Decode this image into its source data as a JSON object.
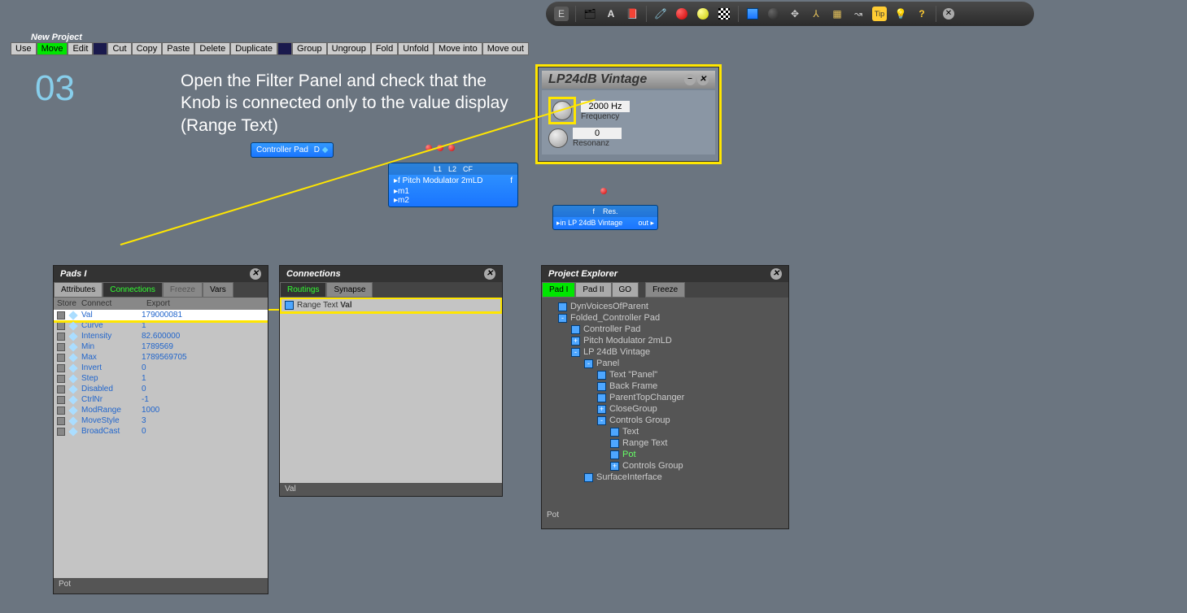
{
  "window_title": "New Project",
  "step_number": "03",
  "step_text": "Open the Filter Panel and check that the Knob is connected only to the value display (Range Text)",
  "mode_buttons": {
    "use": "Use",
    "move": "Move",
    "edit": "Edit"
  },
  "edit_buttons": [
    "Cut",
    "Copy",
    "Paste",
    "Delete",
    "Duplicate"
  ],
  "group_buttons": [
    "Group",
    "Ungroup",
    "Fold",
    "Unfold",
    "Move into",
    "Move out"
  ],
  "controller_pad": {
    "label": "Controller Pad",
    "port": "D"
  },
  "pitch_mod": {
    "title": "Pitch Modulator 2mLD",
    "l1": "L1",
    "l2": "L2",
    "cf": "CF",
    "in1": "m1",
    "in2": "m2",
    "out": "f"
  },
  "lp_node": {
    "f": "f",
    "res": "Res.",
    "in": "in",
    "name": "LP 24dB Vintage",
    "out": "out"
  },
  "filter_panel": {
    "title": "LP24dB Vintage",
    "freq_val": "2000 Hz",
    "freq_label": "Frequency",
    "res_val": "0",
    "res_label": "Resonanz"
  },
  "pads_panel": {
    "title": "Pads I",
    "tabs": {
      "attributes": "Attributes",
      "connections": "Connections",
      "freeze": "Freeze",
      "vars": "Vars"
    },
    "header": {
      "store": "Store",
      "connect": "Connect",
      "export": "Export"
    },
    "rows": [
      {
        "name": "Val",
        "val": "179000081",
        "hl": true
      },
      {
        "name": "Curve",
        "val": "1"
      },
      {
        "name": "Intensity",
        "val": "82.600000"
      },
      {
        "name": "Min",
        "val": "1789569"
      },
      {
        "name": "Max",
        "val": "1789569705"
      },
      {
        "name": "Invert",
        "val": "0"
      },
      {
        "name": "Step",
        "val": "1"
      },
      {
        "name": "Disabled",
        "val": "0"
      },
      {
        "name": "CtrlNr",
        "val": "-1"
      },
      {
        "name": "ModRange",
        "val": "1000"
      },
      {
        "name": "MoveStyle",
        "val": "3"
      },
      {
        "name": "BroadCast",
        "val": "0"
      }
    ],
    "status": "Pot"
  },
  "connections_panel": {
    "title": "Connections",
    "tabs": {
      "routings": "Routings",
      "synapse": "Synapse"
    },
    "item_prefix": "Range Text",
    "item_suffix": "Val",
    "status": "Val"
  },
  "explorer": {
    "title": "Project Explorer",
    "tabs": {
      "pad1": "Pad I",
      "pad2": "Pad II",
      "go": "GO",
      "freeze": "Freeze"
    },
    "tree": [
      {
        "indent": 0,
        "exp": "",
        "label": "DynVoicesOfParent"
      },
      {
        "indent": 0,
        "exp": "-",
        "label": "Folded_Controller Pad"
      },
      {
        "indent": 1,
        "exp": "",
        "label": "Controller Pad"
      },
      {
        "indent": 1,
        "exp": "+",
        "label": "Pitch Modulator 2mLD"
      },
      {
        "indent": 1,
        "exp": "-",
        "label": "LP 24dB Vintage"
      },
      {
        "indent": 2,
        "exp": "-",
        "label": "Panel"
      },
      {
        "indent": 3,
        "exp": "",
        "label": "Text \"Panel\""
      },
      {
        "indent": 3,
        "exp": "",
        "label": "Back Frame"
      },
      {
        "indent": 3,
        "exp": "",
        "label": "ParentTopChanger"
      },
      {
        "indent": 3,
        "exp": "+",
        "label": "CloseGroup"
      },
      {
        "indent": 3,
        "exp": "-",
        "label": "Controls Group"
      },
      {
        "indent": 4,
        "exp": "",
        "label": "Text"
      },
      {
        "indent": 4,
        "exp": "",
        "label": "Range Text"
      },
      {
        "indent": 4,
        "exp": "",
        "label": "Pot",
        "sel": true
      },
      {
        "indent": 4,
        "exp": "+",
        "label": "Controls Group"
      },
      {
        "indent": 2,
        "exp": "",
        "label": "SurfaceInterface"
      }
    ],
    "status": "Pot"
  }
}
